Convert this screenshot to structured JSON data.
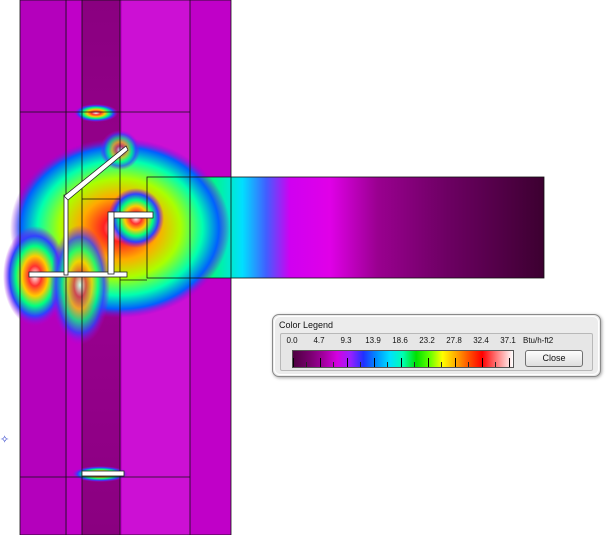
{
  "legend": {
    "title": "Color Legend",
    "ticks": [
      "0.0",
      "4.7",
      "9.3",
      "13.9",
      "18.6",
      "23.2",
      "27.8",
      "32.4",
      "37.1"
    ],
    "units": "Btu/h-ft2",
    "close_label": "Close"
  },
  "icons": {
    "marker": "star-marker-icon"
  },
  "colors": {
    "low": "#4d0040",
    "mid": "#00e0ff",
    "high": "#ffffff",
    "wall_base": "#c400c8"
  }
}
